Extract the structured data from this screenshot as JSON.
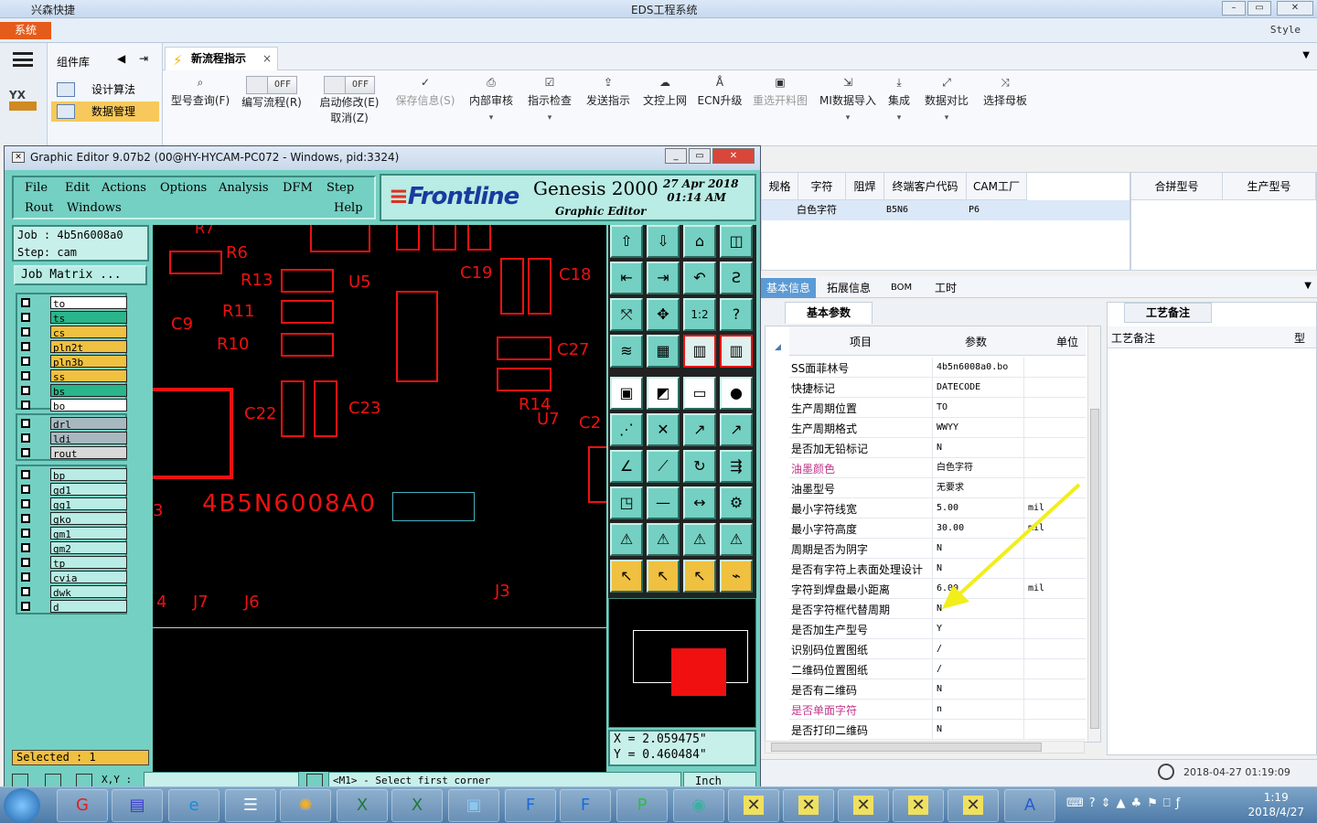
{
  "app": {
    "title": "EDS工程系统",
    "quick_access": "兴森快捷",
    "system_tab": "系统",
    "style_label": "Style"
  },
  "left_panel": {
    "header": "组件库",
    "items": [
      {
        "label": "设计算法"
      },
      {
        "label": "数据管理"
      }
    ]
  },
  "tab": {
    "label": "新流程指示"
  },
  "ribbon": {
    "buttons": [
      {
        "label": "型号查询(F)"
      },
      {
        "label": "编写流程(R)",
        "toggle": "OFF"
      },
      {
        "label": "启动修改(E)",
        "sub": "取消(Z)",
        "toggle": "OFF"
      },
      {
        "label": "保存信息(S)"
      },
      {
        "label": "内部审核"
      },
      {
        "label": "指示检查"
      },
      {
        "label": "发送指示"
      },
      {
        "label": "文控上网"
      },
      {
        "label": "ECN升级"
      },
      {
        "label": "重选开料图"
      },
      {
        "label": "MI数据导入"
      },
      {
        "label": "集成"
      },
      {
        "label": "数据对比"
      },
      {
        "label": "选择母板"
      }
    ]
  },
  "top_grid": {
    "headers": [
      "规格",
      "字符",
      "阻焊",
      "终端客户代码",
      "CAM工厂"
    ],
    "row": [
      "",
      "白色字符",
      "",
      "B5N6",
      "P6"
    ],
    "right_headers": [
      "合拼型号",
      "生产型号"
    ]
  },
  "subtabs": [
    "基本信息",
    "拓展信息",
    "BOM",
    "工时"
  ],
  "basic_params": {
    "tab": "基本参数",
    "headers": {
      "item": "项目",
      "param": "参数",
      "unit": "单位"
    },
    "rows": [
      {
        "k": "SS面菲林号",
        "v": "4b5n6008a0.bo",
        "u": ""
      },
      {
        "k": "快捷标记",
        "v": "DATECODE",
        "u": ""
      },
      {
        "k": "生产周期位置",
        "v": "TO",
        "u": ""
      },
      {
        "k": "生产周期格式",
        "v": "WWYY",
        "u": ""
      },
      {
        "k": "是否加无铅标记",
        "v": "N",
        "u": ""
      },
      {
        "k": "油墨颜色",
        "v": "白色字符",
        "u": ""
      },
      {
        "k": "油墨型号",
        "v": "无要求",
        "u": ""
      },
      {
        "k": "最小字符线宽",
        "v": "5.00",
        "u": "mil"
      },
      {
        "k": "最小字符高度",
        "v": "30.00",
        "u": "mil"
      },
      {
        "k": "周期是否为阴字",
        "v": "N",
        "u": ""
      },
      {
        "k": "是否有字符上表面处理设计",
        "v": "N",
        "u": ""
      },
      {
        "k": "字符到焊盘最小距离",
        "v": "6.00",
        "u": "mil"
      },
      {
        "k": "是否字符框代替周期",
        "v": "N",
        "u": ""
      },
      {
        "k": "是否加生产型号",
        "v": "Y",
        "u": ""
      },
      {
        "k": "识别码位置图纸",
        "v": "/",
        "u": ""
      },
      {
        "k": "二维码位置图纸",
        "v": "/",
        "u": ""
      },
      {
        "k": "是否有二维码",
        "v": "N",
        "u": ""
      },
      {
        "k": "是否单面字符",
        "v": "n",
        "u": ""
      },
      {
        "k": "是否打印二维码",
        "v": "N",
        "u": ""
      }
    ]
  },
  "notes": {
    "tab": "工艺备注",
    "header": "工艺备注",
    "col": "型"
  },
  "status": {
    "timestamp": "2018-04-27 01:19:09"
  },
  "ge": {
    "title": "Graphic Editor 9.07b2 (00@HY-HYCAM-PC072 - Windows, pid:3324)",
    "menu": [
      "File",
      "Edit",
      "Actions",
      "Options",
      "Analysis",
      "DFM",
      "Step",
      "Rout",
      "Windows",
      "Help"
    ],
    "logo": {
      "brand": "Frontline",
      "product": "Genesis 2000",
      "date": "27 Apr 2018",
      "time": "01:14 AM",
      "sub": "Graphic Editor"
    },
    "job": "Job : 4b5n6008a0",
    "step": "Step: cam",
    "job_matrix": "Job Matrix ...",
    "layers_group1": [
      "to",
      "ts",
      "cs",
      "pln2t",
      "pln3b",
      "ss",
      "bs",
      "bo"
    ],
    "layers_group2": [
      "drl",
      "ldi",
      "rout"
    ],
    "layers_group3": [
      "bp",
      "gd1",
      "gg1",
      "gko",
      "gm1",
      "gm2",
      "tp",
      "cvia",
      "dwk",
      "d"
    ],
    "selected": "Selected : 1",
    "coords": {
      "x": "X = 2.059475\"",
      "y": "Y = 0.460484\""
    },
    "prompt_label": "X,Y :",
    "message": "<M1> - Select first corner",
    "unit": "Inch",
    "pcb_labels": [
      "R7",
      "R6",
      "R13",
      "U5",
      "C19",
      "C18",
      "C9",
      "R11",
      "R10",
      "C27",
      "C22",
      "C23",
      "R14",
      "U7",
      "C2",
      "4B5N6008A0",
      "J7",
      "J6",
      "J3",
      "4",
      "3"
    ]
  },
  "taskbar": {
    "time": "1:19",
    "date": "2018/4/27"
  }
}
